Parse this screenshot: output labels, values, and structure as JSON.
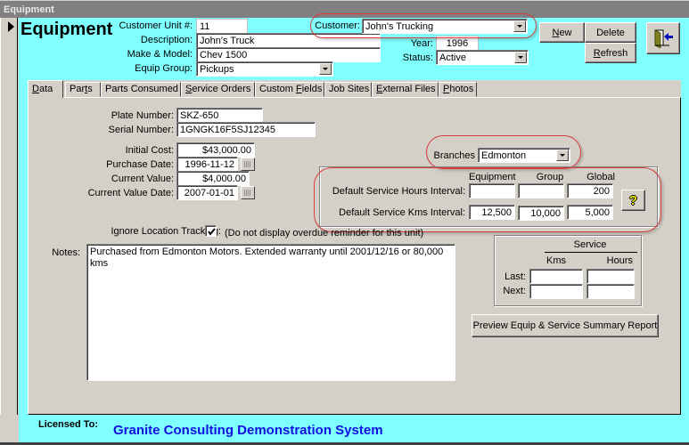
{
  "window": {
    "title": "Equipment"
  },
  "header": {
    "form_title": "Equipment",
    "customer_unit_label": "Customer Unit #:",
    "customer_unit_value": "11",
    "description_label": "Description:",
    "description_value": "John's Truck",
    "make_model_label": "Make & Model:",
    "make_model_value": "Chev  1500",
    "equip_group_label": "Equip Group:",
    "equip_group_value": "Pickups",
    "customer_label": "Customer:",
    "customer_value": "John's Trucking",
    "year_label": "Year:",
    "year_value": "1996",
    "status_label": "Status:",
    "status_value": "Active"
  },
  "toolbar": {
    "new_label": "New",
    "new_accel": "N",
    "new_rest": "ew",
    "delete_label": "Delete",
    "refresh_accel": "R",
    "refresh_rest": "efresh",
    "exit_icon": "exit-door-icon"
  },
  "tabs": [
    {
      "label": "Data",
      "accel": "D",
      "rest": "ata",
      "active": true
    },
    {
      "label": "Parts",
      "pre": "Par",
      "accel": "t",
      "rest": "s"
    },
    {
      "label": "Parts Consumed"
    },
    {
      "label": "Service Orders",
      "accel": "S",
      "rest": "ervice Orders"
    },
    {
      "label": "Custom Fields",
      "pre": "Custom ",
      "accel": "F",
      "rest": "ields"
    },
    {
      "label": "Job Sites"
    },
    {
      "label": "External Files",
      "accel": "E",
      "rest": "xternal Files"
    },
    {
      "label": "Photos",
      "accel": "P",
      "rest": "hotos"
    }
  ],
  "data_tab": {
    "plate_number_label": "Plate Number:",
    "plate_number_value": "SKZ-650",
    "serial_number_label": "Serial Number:",
    "serial_number_value": "1GNGK16F5SJ12345",
    "initial_cost_label": "Initial Cost:",
    "initial_cost_value": "$43,000.00",
    "purchase_date_label": "Purchase Date:",
    "purchase_date_value": "1996-11-12",
    "current_value_label": "Current Value:",
    "current_value_value": "$4,000.00",
    "current_value_date_label": "Current Value Date:",
    "current_value_date_value": "2007-01-01",
    "branches_label": "Branches",
    "branches_value": "Edmonton",
    "intervals": {
      "col_equipment": "Equipment",
      "col_group": "Group",
      "col_global": "Global",
      "hours_label": "Default Service Hours Interval:",
      "hours_equipment": "",
      "hours_group": "",
      "hours_global": "200",
      "kms_label": "Default Service Kms Interval:",
      "kms_equipment": "12,500",
      "kms_group": "10,000",
      "kms_global": "5,000",
      "help_icon": "question-mark-icon",
      "help_glyph": "?"
    },
    "ignore_tracking_label": "Ignore Location Tracking:",
    "ignore_tracking_checked": true,
    "ignore_tracking_note": "(Do not display overdue reminder for this unit)",
    "notes_label": "Notes:",
    "notes_value": "Purchased from Edmonton Motors.   Extended warranty until 2001/12/16 or 80,000 kms",
    "service": {
      "title": "Service",
      "col_kms": "Kms",
      "col_hours": "Hours",
      "last_label": "Last:",
      "next_label": "Next:",
      "last_kms": "",
      "last_hours": "",
      "next_kms": "",
      "next_hours": ""
    },
    "report_button_label": "Preview Equip & Service Summary Report"
  },
  "footer": {
    "licensed_to_label": "Licensed To:",
    "licensed_to_value": "Granite Consulting Demonstration System"
  },
  "colors": {
    "form_background": "#80ffff",
    "panel": "#d4d0c8",
    "titlebar": "#808080",
    "license_text": "#1010e0",
    "highlight_oval": "#d83c3c"
  }
}
